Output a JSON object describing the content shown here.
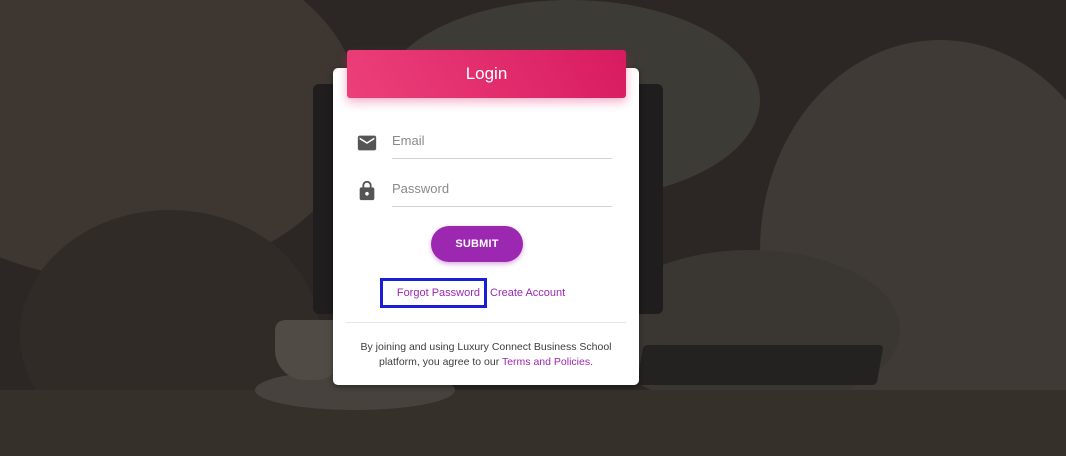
{
  "login": {
    "title": "Login",
    "email_placeholder": "Email",
    "password_placeholder": "Password",
    "submit_label": "SUBMIT",
    "forgot_password_label": "Forgot Password",
    "create_account_label": "Create Account",
    "terms_text": "By joining and using Luxury Connect Business School platform, you agree to our",
    "terms_link_label": "Terms and Policies."
  },
  "icons": {
    "email": "mail-icon",
    "password": "lock-icon"
  },
  "colors": {
    "header_gradient_start": "#ec407a",
    "header_gradient_end": "#d81b60",
    "submit_button": "#9c27b0",
    "link": "#9c27b0",
    "highlight_box": "#1a1fd6"
  }
}
